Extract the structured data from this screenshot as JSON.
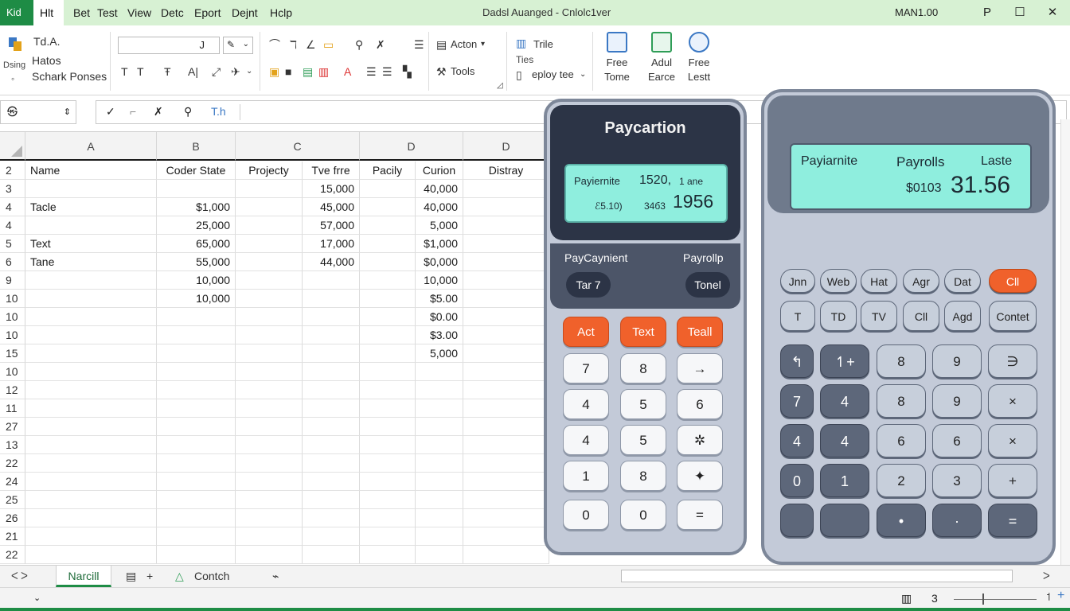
{
  "titlebar": {
    "app_badge": "Kid",
    "menu": [
      "Hlt",
      "Bet",
      "Test",
      "View",
      "Detc",
      "Eport",
      "Dejnt",
      "Hclp"
    ],
    "window_title": "Dadsl Auanged - Cnlolc1ver",
    "user": "MAN1.00",
    "controls": [
      "P",
      "☐",
      "✕"
    ]
  },
  "ribbon": {
    "clip_group": {
      "line1": "Td.A.",
      "line2": "Hatos",
      "line3": "Schark Ponses",
      "side": "Dsing"
    },
    "action_label": "Acton",
    "tools_label": "Tools",
    "chart_label": "Trile",
    "ties_label": "Ties",
    "employ_label": "eploy tee",
    "big_buttons": [
      {
        "line1": "Free",
        "line2": "Tome",
        "color": "#3b78c4"
      },
      {
        "line1": "Adul",
        "line2": "Earce",
        "color": "#2f9d57"
      },
      {
        "line1": "Free",
        "line2": "Lestt",
        "color": "#3b78c4"
      }
    ],
    "font_glyphs": [
      "T",
      "T",
      "Ŧ",
      "A|"
    ],
    "size_glyph": "J"
  },
  "formula_bar": {
    "namebox": "㉿",
    "tools": [
      "✓",
      "⌐",
      "✗",
      "⚲",
      "T.h"
    ]
  },
  "grid": {
    "columns": [
      {
        "label": "A"
      },
      {
        "label": "B"
      },
      {
        "label": "C"
      },
      {
        "label": "D"
      },
      {
        "label": "D"
      }
    ],
    "rows": [
      {
        "n": "2",
        "cells": [
          "Name",
          "Coder State",
          "Projecty",
          "Tve frre",
          "Pacily",
          "Curion",
          "Distray"
        ]
      },
      {
        "n": "3",
        "cells": [
          "",
          "",
          "",
          "15,000",
          "",
          "40,000",
          ""
        ]
      },
      {
        "n": "4",
        "cells": [
          "Tacle",
          "$1,000",
          "",
          "45,000",
          "",
          "40,000",
          ""
        ]
      },
      {
        "n": "4",
        "cells": [
          "",
          "25,000",
          "",
          "57,000",
          "",
          "5,000",
          ""
        ]
      },
      {
        "n": "5",
        "cells": [
          "Text",
          "65,000",
          "",
          "17,000",
          "",
          "$1,000",
          ""
        ]
      },
      {
        "n": "6",
        "cells": [
          "Tane",
          "55,000",
          "",
          "44,000",
          "",
          "$0,000",
          ""
        ]
      },
      {
        "n": "9",
        "cells": [
          "",
          "10,000",
          "",
          "",
          "",
          "10,000",
          ""
        ]
      },
      {
        "n": "10",
        "cells": [
          "",
          "10,000",
          "",
          "",
          "",
          "$5.00",
          ""
        ]
      },
      {
        "n": "10",
        "cells": [
          "",
          "",
          "",
          "",
          "",
          "$0.00",
          ""
        ]
      },
      {
        "n": "10",
        "cells": [
          "",
          "",
          "",
          "",
          "",
          "$3.00",
          ""
        ]
      },
      {
        "n": "15",
        "cells": [
          "",
          "",
          "",
          "",
          "",
          "5,000",
          ""
        ]
      },
      {
        "n": "10",
        "cells": [
          "",
          "",
          "",
          "",
          "",
          "",
          ""
        ]
      },
      {
        "n": "12",
        "cells": [
          "",
          "",
          "",
          "",
          "",
          "",
          ""
        ]
      },
      {
        "n": "11",
        "cells": [
          "",
          "",
          "",
          "",
          "",
          "",
          ""
        ]
      },
      {
        "n": "27",
        "cells": [
          "",
          "",
          "",
          "",
          "",
          "",
          ""
        ]
      },
      {
        "n": "13",
        "cells": [
          "",
          "",
          "",
          "",
          "",
          "",
          ""
        ]
      },
      {
        "n": "22",
        "cells": [
          "",
          "",
          "",
          "",
          "",
          "",
          ""
        ]
      },
      {
        "n": "24",
        "cells": [
          "",
          "",
          "",
          "",
          "",
          "",
          ""
        ]
      },
      {
        "n": "25",
        "cells": [
          "",
          "",
          "",
          "",
          "",
          "",
          ""
        ]
      },
      {
        "n": "26",
        "cells": [
          "",
          "",
          "",
          "",
          "",
          "",
          ""
        ]
      },
      {
        "n": "21",
        "cells": [
          "",
          "",
          "",
          "",
          "",
          "",
          ""
        ]
      },
      {
        "n": "22",
        "cells": [
          "",
          "",
          "",
          "",
          "",
          "",
          ""
        ]
      }
    ]
  },
  "calc1": {
    "title": "Paycartion",
    "screen": {
      "label": "Payiernite",
      "top_value": "1520,",
      "top_unit": "1 ane",
      "sub": "ℰ5.10)",
      "sub2": "34б3",
      "big": "1956"
    },
    "mid_left": "PayCaynient",
    "mid_right": "Payrollp",
    "pill_left": "Tar 7",
    "pill_right": "Tonel",
    "keys": [
      [
        "Act",
        "Text",
        "Teall"
      ],
      [
        "7",
        "8",
        "→"
      ],
      [
        "4",
        "5",
        "6"
      ],
      [
        "4",
        "5",
        "✲"
      ],
      [
        "1",
        "8",
        "✦"
      ],
      [
        "0",
        "0",
        "="
      ]
    ]
  },
  "calc2": {
    "screen": {
      "label1": "Payiarnite",
      "label2": "Payrolls",
      "label3": "Laste",
      "sub": "$0103",
      "big": "31.56"
    },
    "row1": [
      "Jnn",
      "Web",
      "Hat",
      "Agr",
      "Dat",
      "Cll"
    ],
    "row2": [
      "T",
      "TD",
      "TV",
      "Cll",
      "Agd",
      "Contet"
    ],
    "keys": [
      [
        "↰",
        "↿+",
        "8",
        "9",
        "∋"
      ],
      [
        "7",
        "4",
        "8",
        "9",
        "×"
      ],
      [
        "4",
        "4",
        "6",
        "6",
        "×"
      ],
      [
        "0",
        "1",
        "2",
        "3",
        "+"
      ],
      [
        "",
        "",
        "•",
        "·",
        "="
      ]
    ]
  },
  "sheet_tabs": {
    "nav": "ᐸ ᐳ",
    "active": "Narcill",
    "add": "+",
    "second": "Contch",
    "status_page": "3"
  }
}
